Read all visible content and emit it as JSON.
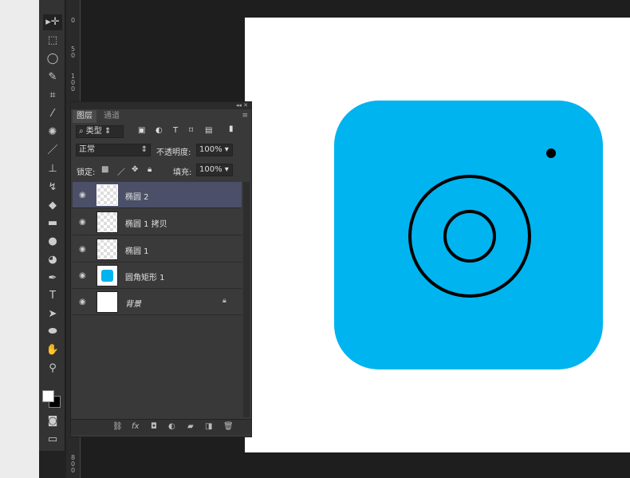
{
  "tools": [
    "move",
    "marquee",
    "lasso",
    "quick-select",
    "crop",
    "eyedropper",
    "healing",
    "brush",
    "stamp",
    "history-brush",
    "eraser",
    "gradient",
    "blur",
    "dodge",
    "pen",
    "type",
    "path-select",
    "ellipse",
    "hand",
    "zoom"
  ],
  "ruler_labels": [
    "0",
    "50",
    "100",
    "800"
  ],
  "panel": {
    "tabs": [
      "图层",
      "通道"
    ],
    "filter_kind": "类型",
    "blend_mode": "正常",
    "opacity_label": "不透明度:",
    "opacity": "100%",
    "lock_label": "锁定:",
    "fill_label": "填充:",
    "fill": "100%",
    "layers": [
      {
        "name": "椭圆 2",
        "selected": true
      },
      {
        "name": "椭圆 1 拷贝"
      },
      {
        "name": "椭圆 1"
      },
      {
        "name": "圆角矩形 1"
      },
      {
        "name": "背景",
        "locked": true
      }
    ],
    "bottom_fx": "fx"
  },
  "colors": {
    "shape_fill": "#00b4ef",
    "foreground": "#ffffff",
    "background": "#000000"
  }
}
